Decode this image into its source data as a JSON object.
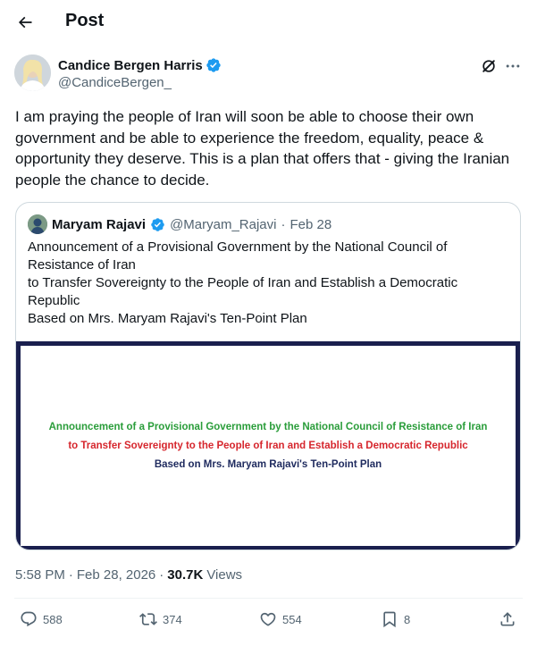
{
  "header": {
    "title": "Post",
    "back_icon": "arrow-left-icon"
  },
  "author": {
    "name": "Candice Bergen Harris",
    "handle": "@CandiceBergen_",
    "verified": true,
    "verified_color": "#1d9bf0"
  },
  "post": {
    "text": "I am praying the people of Iran will soon be able to choose their own government and be able to experience the freedom, equality, peace & opportunity they deserve. This is a plan that offers that - giving the Iranian people the chance to decide."
  },
  "quote": {
    "name": "Maryam Rajavi",
    "handle": "@Maryam_Rajavi",
    "separator": "·",
    "date": "Feb 28",
    "text_line_1": "Announcement of a Provisional Government by the National Council of Resistance of Iran",
    "text_line_2": "to Transfer Sovereignty to the People of Iran and Establish a Democratic Republic",
    "text_line_3": "Based on Mrs. Maryam Rajavi's Ten-Point Plan",
    "image": {
      "line_1": "Announcement of a Provisional Government by the National Council of Resistance of Iran",
      "line_2": "to Transfer Sovereignty to the People of Iran and Establish a Democratic Republic",
      "line_3": "Based on Mrs. Maryam Rajavi's Ten-Point Plan",
      "frame_color": "#1a1f4e",
      "line_1_color": "#2a9d3a",
      "line_2_color": "#d6262d",
      "line_3_color": "#1e2a5e"
    }
  },
  "meta": {
    "time": "5:58 PM",
    "sep1": "·",
    "date": "Feb 28, 2026",
    "sep2": "·",
    "views": "30.7K",
    "views_label": "Views"
  },
  "actions": {
    "replies": "588",
    "reposts": "374",
    "likes": "554",
    "bookmarks": "8"
  },
  "colors": {
    "text": "#0f1419",
    "secondary": "#536471",
    "border": "#cfd9de",
    "accent": "#1d9bf0"
  }
}
